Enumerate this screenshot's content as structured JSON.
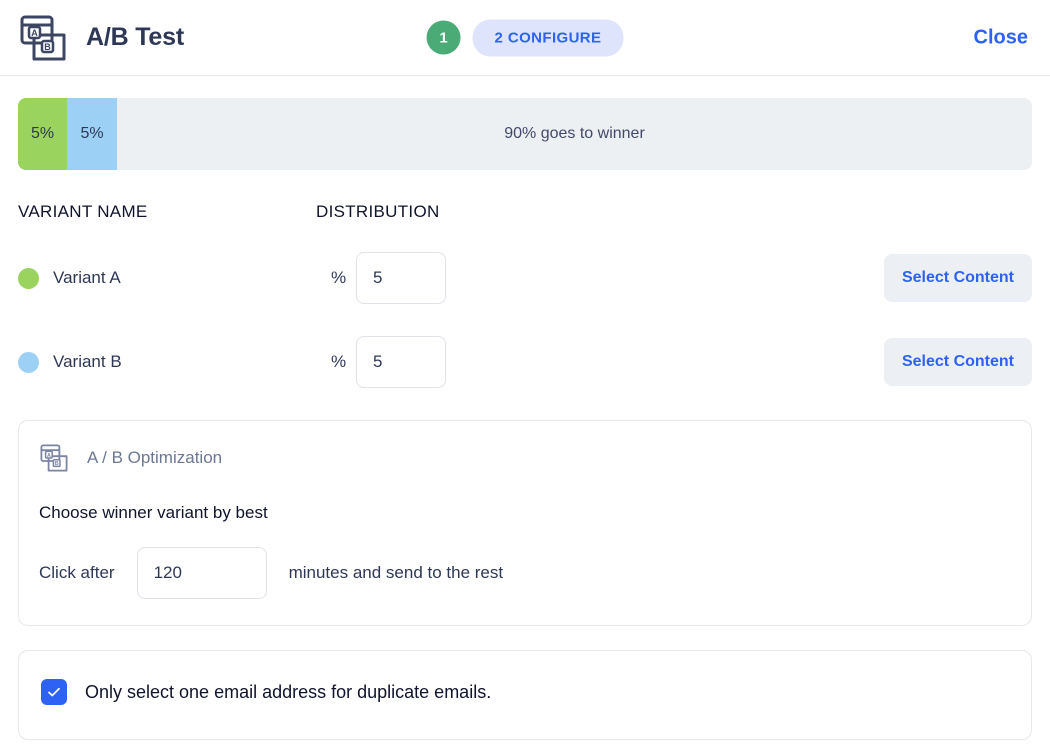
{
  "header": {
    "icon": "ab-test-icon",
    "title": "A/B Test",
    "steps": [
      {
        "number": "1",
        "label": "",
        "state": "done"
      },
      {
        "number": "2",
        "label": "2 CONFIGURE",
        "state": "active"
      }
    ],
    "close_label": "Close"
  },
  "distribution_bar": {
    "segments": [
      {
        "name": "Variant A",
        "label": "5%",
        "percent": 5,
        "color": "#9ad45f"
      },
      {
        "name": "Variant B",
        "label": "5%",
        "percent": 5,
        "color": "#9cd1f5"
      }
    ],
    "remainder_label": "90% goes to winner",
    "remainder_percent": 90,
    "remainder_color": "#edf0f2"
  },
  "table": {
    "headers": {
      "variant_name": "VARIANT NAME",
      "distribution": "DISTRIBUTION"
    },
    "rows": [
      {
        "dot_color": "#9ad45f",
        "name": "Variant A",
        "percent_symbol": "%",
        "percent_value": "5",
        "percent_placeholder": "5",
        "action_label": "Select Content"
      },
      {
        "dot_color": "#9cd1f5",
        "name": "Variant B",
        "percent_symbol": "%",
        "percent_value": "5",
        "percent_placeholder": "5",
        "action_label": "Select Content"
      }
    ]
  },
  "optimization_card": {
    "icon": "ab-test-icon",
    "title": "A / B Optimization",
    "subtitle": "Choose winner variant by best",
    "metric_label": "Click after",
    "minutes_value": "120",
    "minutes_placeholder": "120",
    "suffix_label": "minutes and send to the rest"
  },
  "duplicate_card": {
    "checkbox_checked": true,
    "label": "Only select one email address for duplicate emails."
  },
  "colors": {
    "accent_blue": "#2d62f5",
    "step_green": "#4aab77",
    "variant_a": "#9ad45f",
    "variant_b": "#9cd1f5",
    "bar_track": "#edf0f2",
    "button_bg": "#eceff3"
  }
}
